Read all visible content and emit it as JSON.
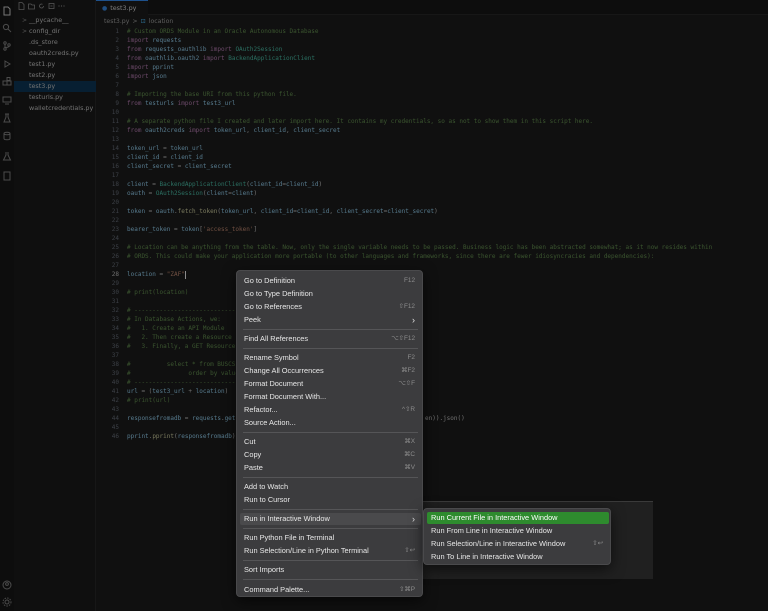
{
  "activity_bar": {
    "icons": [
      "explorer-icon",
      "search-icon",
      "source-control-icon",
      "run-debug-icon",
      "extensions-icon",
      "remote-icon",
      "testing-icon",
      "database-icon",
      "flask-icon",
      "files-icon",
      "account-icon",
      "settings-icon"
    ]
  },
  "sidebar": {
    "items": [
      {
        "label": "__pycache__",
        "chevron": ">",
        "active": false
      },
      {
        "label": "config_dir",
        "chevron": ">",
        "active": false
      },
      {
        "label": ".ds_store",
        "chevron": "",
        "active": false
      },
      {
        "label": "oauth2creds.py",
        "chevron": "",
        "active": false
      },
      {
        "label": "test1.py",
        "chevron": "",
        "active": false
      },
      {
        "label": "test2.py",
        "chevron": "",
        "active": false
      },
      {
        "label": "test3.py",
        "chevron": "",
        "active": true
      },
      {
        "label": "testurls.py",
        "chevron": "",
        "active": false
      },
      {
        "label": "walletcredentials.py",
        "chevron": "",
        "active": false
      }
    ]
  },
  "tab": {
    "label": "test3.py"
  },
  "breadcrumb": {
    "file": "test3.py",
    "separator": ">",
    "symbol": "location"
  },
  "editor": {
    "lines": [
      {
        "n": "1",
        "code": "# Custom ORDS Module in an Oracle Autonomous Database"
      },
      {
        "n": "2",
        "code": "import requests"
      },
      {
        "n": "3",
        "code": "from requests_oauthlib import OAuth2Session"
      },
      {
        "n": "4",
        "code": "from oauthlib.oauth2 import BackendApplicationClient"
      },
      {
        "n": "5",
        "code": "import pprint"
      },
      {
        "n": "6",
        "code": "import json"
      },
      {
        "n": "7",
        "code": ""
      },
      {
        "n": "8",
        "code": "# Importing the base URI from this python file."
      },
      {
        "n": "9",
        "code": "from testurls import test3_url"
      },
      {
        "n": "10",
        "code": ""
      },
      {
        "n": "11",
        "code": "# A separate python file I created and later import here. It contains my credentials, so as not to show them in this script here."
      },
      {
        "n": "12",
        "code": "from oauth2creds import token_url, client_id, client_secret"
      },
      {
        "n": "13",
        "code": ""
      },
      {
        "n": "14",
        "code": "token_url = token_url"
      },
      {
        "n": "15",
        "code": "client_id = client_id"
      },
      {
        "n": "16",
        "code": "client_secret = client_secret"
      },
      {
        "n": "17",
        "code": ""
      },
      {
        "n": "18",
        "code": "client = BackendApplicationClient(client_id=client_id)"
      },
      {
        "n": "19",
        "code": "oauth = OAuth2Session(client=client)"
      },
      {
        "n": "20",
        "code": ""
      },
      {
        "n": "21",
        "code": "token = oauth.fetch_token(token_url, client_id=client_id, client_secret=client_secret)"
      },
      {
        "n": "22",
        "code": ""
      },
      {
        "n": "23",
        "code": "bearer_token = token['access_token']"
      },
      {
        "n": "24",
        "code": ""
      },
      {
        "n": "25",
        "code": "# Location can be anything from the table. Now, only the single variable needs to be passed. Business logic has been abstracted somewhat; as it now resides within"
      },
      {
        "n": "26",
        "code": "# ORDS. This could make your application more portable (to other languages and frameworks, since there are fewer idiosyncracies and dependencies):"
      },
      {
        "n": "27",
        "code": ""
      },
      {
        "n": "28",
        "code": "location = \"ZAF\""
      },
      {
        "n": "29",
        "code": ""
      },
      {
        "n": "30",
        "code": "# print(location)"
      },
      {
        "n": "31",
        "code": ""
      },
      {
        "n": "32",
        "code": "# ----------------------------------"
      },
      {
        "n": "33",
        "code": "# In Database Actions, we:"
      },
      {
        "n": "34",
        "code": "#   1. Create an API Module"
      },
      {
        "n": "35",
        "code": "#   2. Then create a Resource"
      },
      {
        "n": "36",
        "code": "#   3. Finally, a GET Resource"
      },
      {
        "n": "37",
        "code": ""
      },
      {
        "n": "38",
        "code": "#          select * from BUSCS"
      },
      {
        "n": "39",
        "code": "#                order by value"
      },
      {
        "n": "40",
        "code": "# ----------------------------------"
      },
      {
        "n": "41",
        "code": "url = (test3_url + location)"
      },
      {
        "n": "42",
        "code": "# print(url)"
      },
      {
        "n": "43",
        "code": ""
      },
      {
        "n": "44",
        "code": "responsefromadb = requests.get"
      },
      {
        "n": "45",
        "code": ""
      },
      {
        "n": "46",
        "code": "pprint.pprint(responsefromadb)"
      }
    ],
    "line44_tail": "en)).json()"
  },
  "context_menu": {
    "items": [
      {
        "label": "Go to Definition",
        "shortcut": "F12"
      },
      {
        "label": "Go to Type Definition",
        "shortcut": ""
      },
      {
        "label": "Go to References",
        "shortcut": "⇧F12"
      },
      {
        "label": "Peek",
        "shortcut": "›"
      },
      {
        "label": "Find All References",
        "shortcut": "⌥⇧F12"
      },
      {
        "label": "Rename Symbol",
        "shortcut": "F2"
      },
      {
        "label": "Change All Occurrences",
        "shortcut": "⌘F2"
      },
      {
        "label": "Format Document",
        "shortcut": "⌥⇧F"
      },
      {
        "label": "Format Document With...",
        "shortcut": ""
      },
      {
        "label": "Refactor...",
        "shortcut": "^⇧R"
      },
      {
        "label": "Source Action...",
        "shortcut": ""
      },
      {
        "label": "Cut",
        "shortcut": "⌘X"
      },
      {
        "label": "Copy",
        "shortcut": "⌘C"
      },
      {
        "label": "Paste",
        "shortcut": "⌘V"
      },
      {
        "label": "Add to Watch",
        "shortcut": ""
      },
      {
        "label": "Run to Cursor",
        "shortcut": ""
      },
      {
        "label": "Run in Interactive Window",
        "shortcut": "›"
      },
      {
        "label": "Run Python File in Terminal",
        "shortcut": ""
      },
      {
        "label": "Run Selection/Line in Python Terminal",
        "shortcut": "⇧↩"
      },
      {
        "label": "Sort Imports",
        "shortcut": ""
      },
      {
        "label": "Command Palette...",
        "shortcut": "⇧⌘P"
      }
    ]
  },
  "submenu": {
    "items": [
      {
        "label": "Run Current File in Interactive Window",
        "shortcut": ""
      },
      {
        "label": "Run From Line in Interactive Window",
        "shortcut": ""
      },
      {
        "label": "Run Selection/Line in Interactive Window",
        "shortcut": "⇧↩"
      },
      {
        "label": "Run To Line in Interactive Window",
        "shortcut": ""
      }
    ]
  },
  "colors": {
    "accent": "#3794ff",
    "submenu_selected": "#2e8b2e",
    "comment": "#6a9955",
    "keyword": "#c586c0",
    "string": "#ce9178"
  }
}
